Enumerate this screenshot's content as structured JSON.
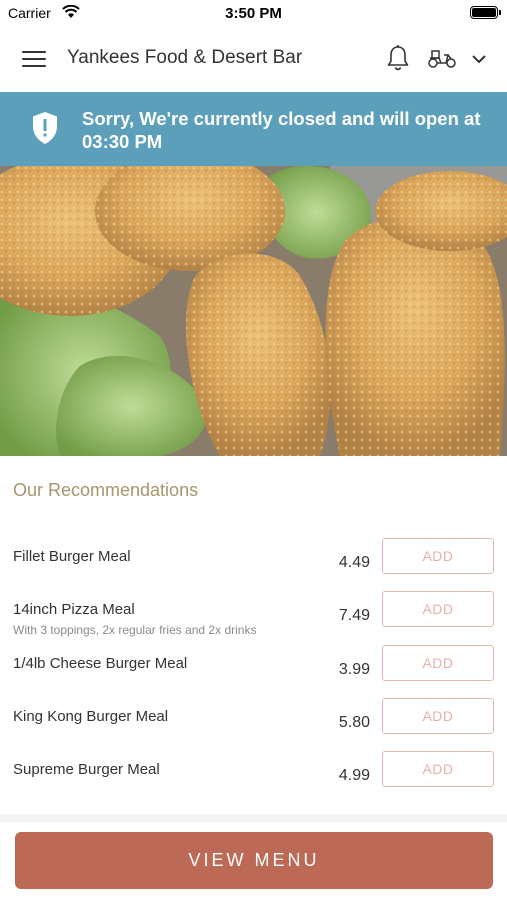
{
  "status_bar": {
    "carrier": "Carrier",
    "time": "3:50 PM"
  },
  "header": {
    "title": "Yankees Food & Desert Bar",
    "icons": [
      "menu-icon",
      "bell-icon",
      "scooter-icon",
      "chevron-down-icon"
    ]
  },
  "banner": {
    "message": "Sorry, We're currently closed and will open at 03:30 PM",
    "icon": "shield-alert-icon",
    "color": "#5c9fba"
  },
  "hero": {
    "subject": "fried chicken tenders on lettuce"
  },
  "recommendations": {
    "title": "Our Recommendations",
    "items": [
      {
        "name": "Fillet Burger Meal",
        "description": "",
        "price": "4.49",
        "add_label": "ADD"
      },
      {
        "name": "14inch Pizza Meal",
        "description": "With 3 toppings, 2x regular fries and 2x drinks",
        "price": "7.49",
        "add_label": "ADD"
      },
      {
        "name": "1/4lb Cheese Burger Meal",
        "description": "",
        "price": "3.99",
        "add_label": "ADD"
      },
      {
        "name": "King Kong Burger Meal",
        "description": "",
        "price": "5.80",
        "add_label": "ADD"
      },
      {
        "name": "Supreme Burger Meal",
        "description": "",
        "price": "4.99",
        "add_label": "ADD"
      }
    ]
  },
  "footer": {
    "view_menu_label": "VIEW MENU",
    "accent_color": "#bc6a56"
  }
}
